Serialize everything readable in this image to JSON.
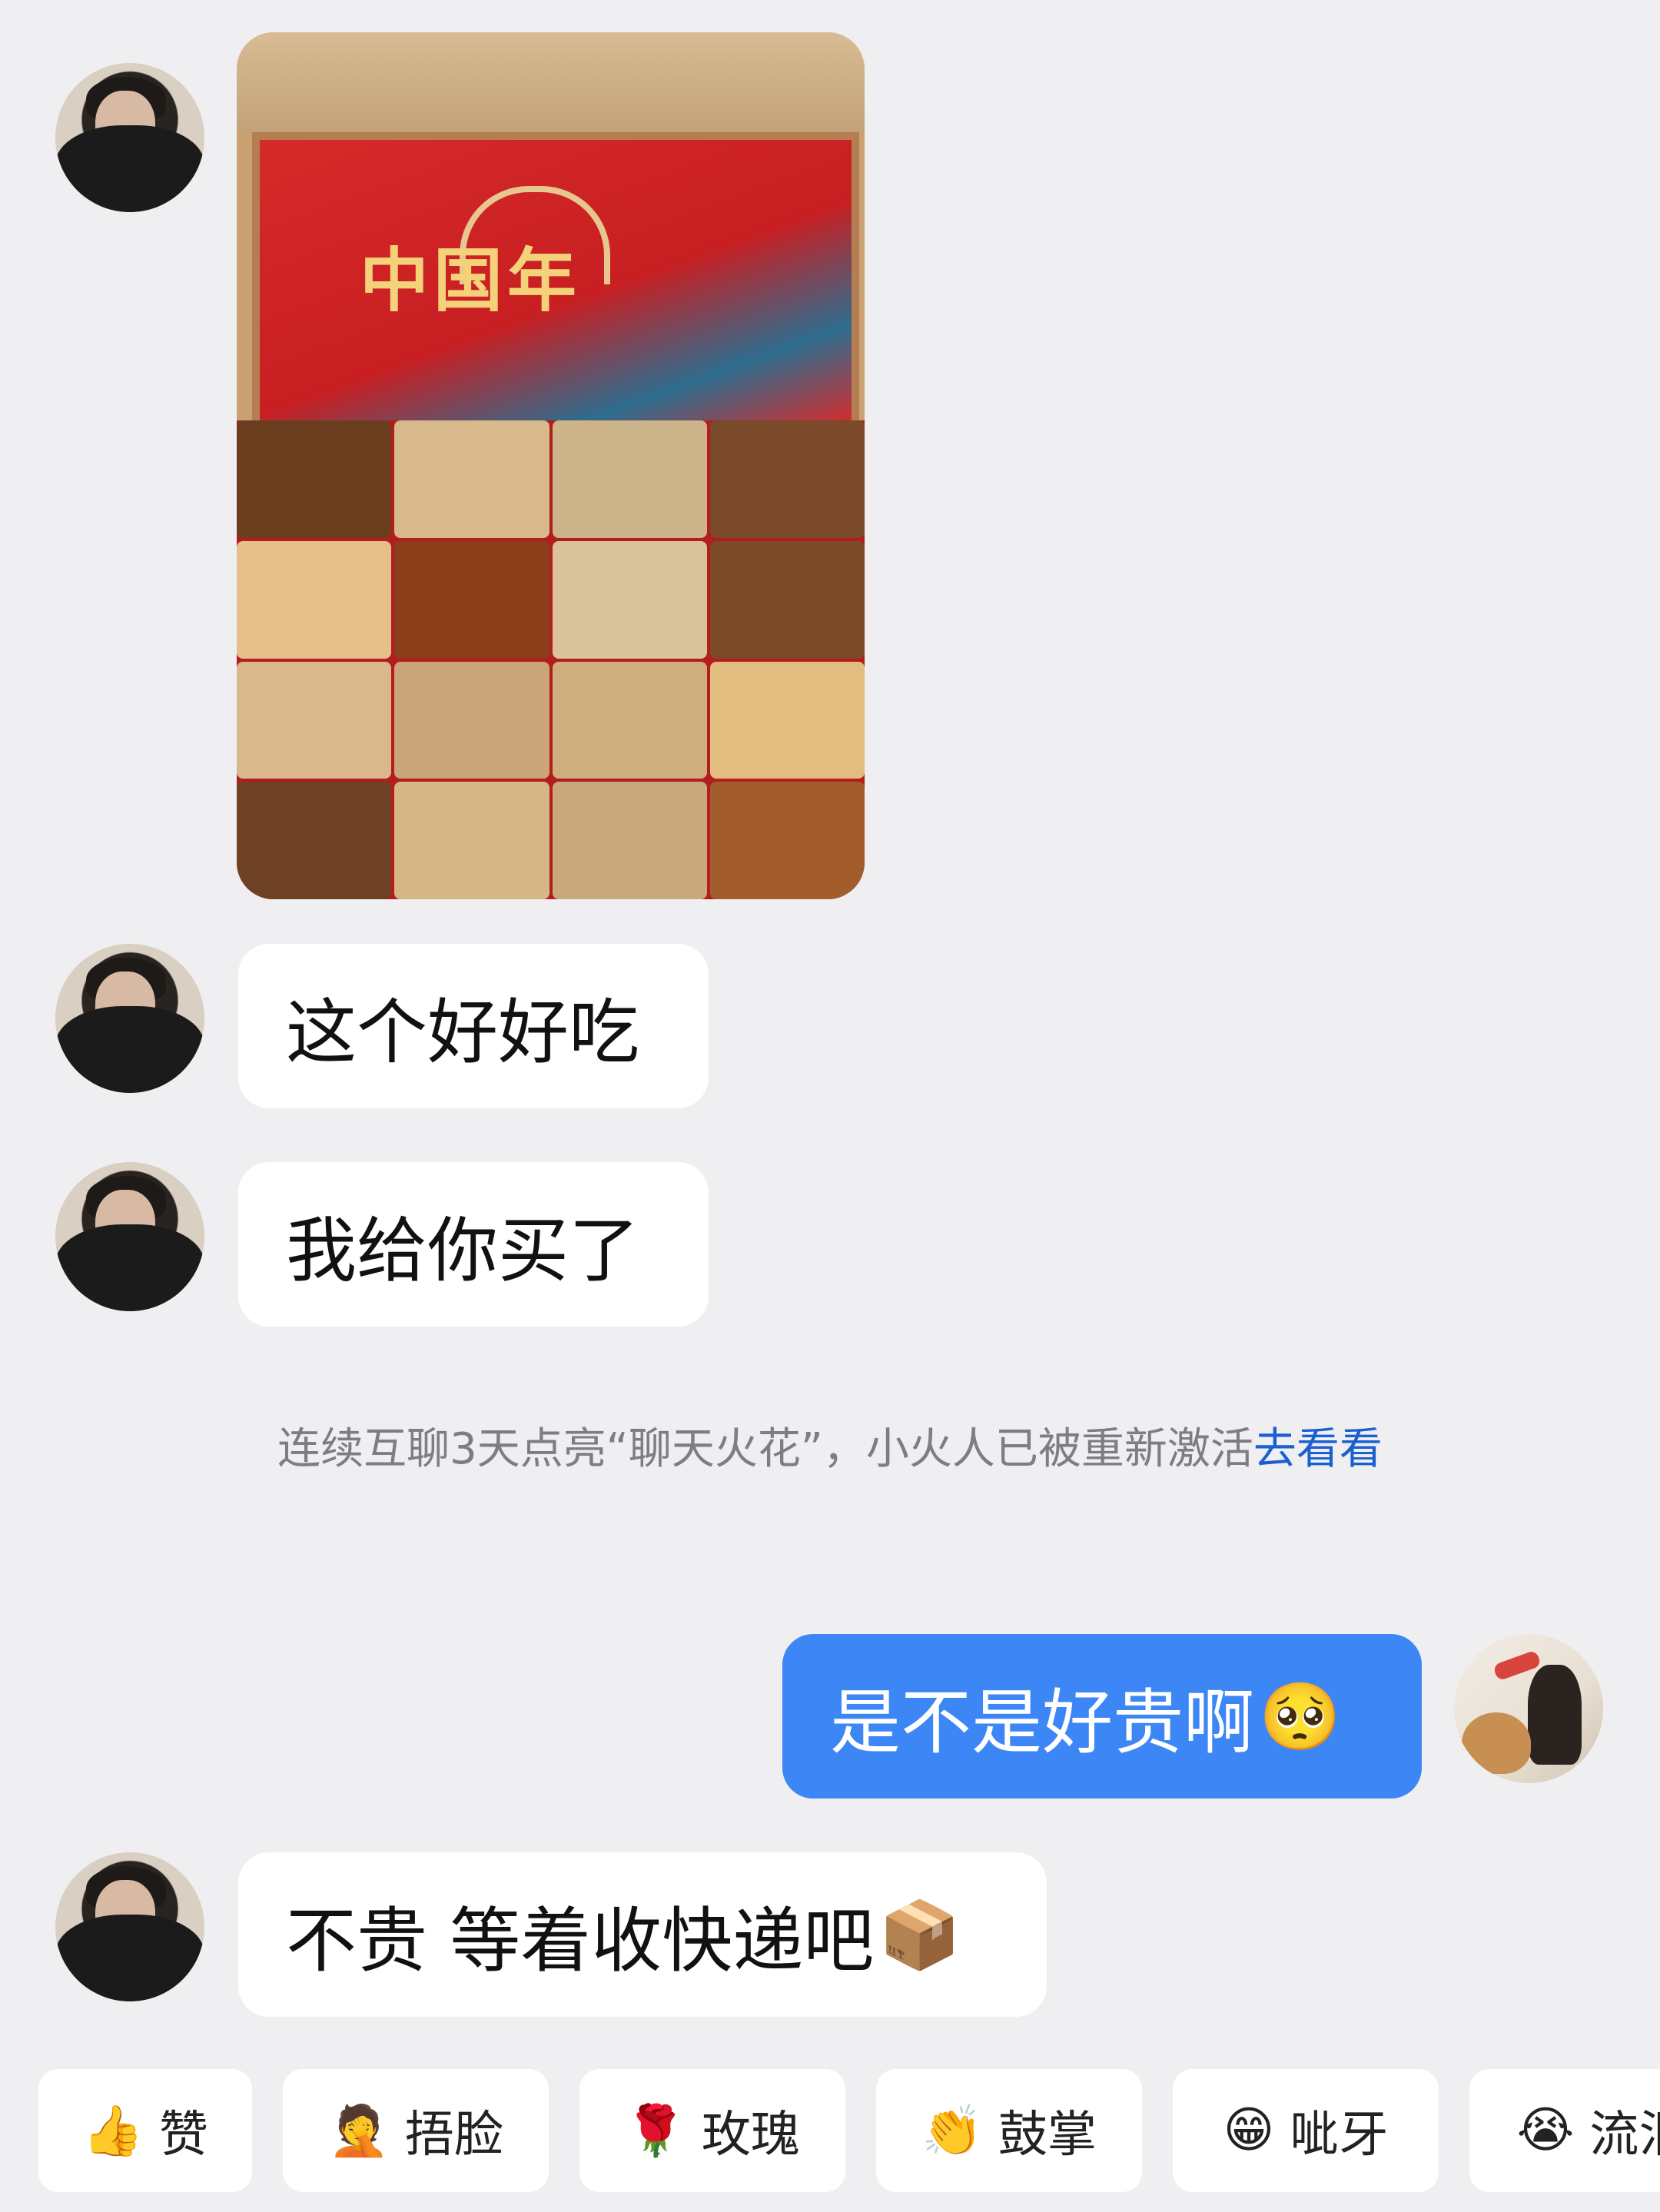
{
  "chat": {
    "photo": {
      "lid_title": "中国年"
    },
    "messages": [
      {
        "sender": "other",
        "text": "这个好好吃"
      },
      {
        "sender": "other",
        "text": "我给你买了"
      },
      {
        "sender": "me",
        "text": "是不是好贵啊",
        "emoji": "🥺"
      },
      {
        "sender": "other",
        "text": "不贵 等着收快递吧",
        "emoji": "📦"
      }
    ],
    "system_notice": {
      "text": "连续互聊3天点亮“聊天火花”，小火人已被重新激活",
      "link_text": "去看看"
    }
  },
  "reactions": [
    {
      "emoji": "👍",
      "label": "赞"
    },
    {
      "emoji": "🤦",
      "label": "捂脸"
    },
    {
      "emoji": "🌹",
      "label": "玫瑰"
    },
    {
      "emoji": "👏",
      "label": "鼓掌"
    },
    {
      "emoji": "😁",
      "label": "呲牙"
    },
    {
      "emoji": "😭",
      "label": "流泪"
    }
  ],
  "colors": {
    "background": "#efeff1",
    "bubble_other": "#ffffff",
    "bubble_mine": "#3d86f6",
    "link": "#1a5fd1",
    "notice_text": "#7d7d82"
  }
}
